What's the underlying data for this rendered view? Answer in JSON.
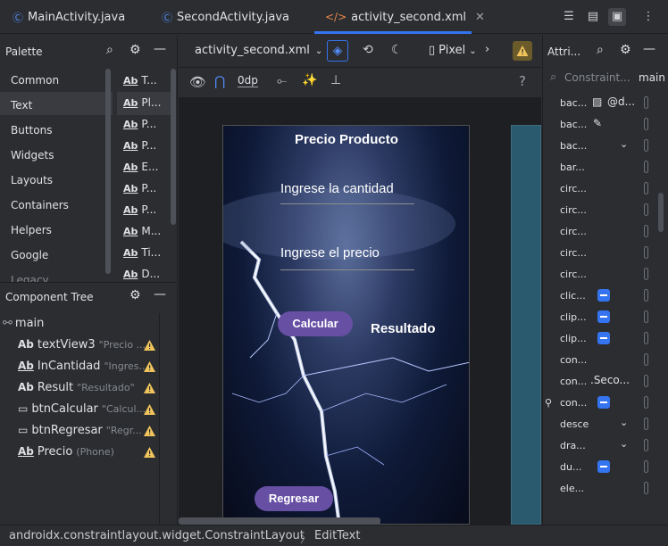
{
  "tabs": [
    {
      "label": "MainActivity.java",
      "icon": "c-class-icon"
    },
    {
      "label": "SecondActivity.java",
      "icon": "c-class-icon"
    },
    {
      "label": "activity_second.xml",
      "icon": "xml-icon"
    }
  ],
  "palette": {
    "title": "Palette",
    "categories": [
      "Common",
      "Text",
      "Buttons",
      "Widgets",
      "Layouts",
      "Containers",
      "Helpers",
      "Google",
      "Legacy"
    ],
    "selected_category": "Text",
    "items": [
      "T...",
      "Pl...",
      "P...",
      "P...",
      "E...",
      "P...",
      "P...",
      "M...",
      "Ti...",
      "D..."
    ]
  },
  "component_tree": {
    "title": "Component Tree",
    "root": "main",
    "items": [
      {
        "lead": "Ab",
        "name": "textView3",
        "hint": "\"Precio ..."
      },
      {
        "lead": "Ab",
        "name": "InCantidad",
        "hint": "\"Ingres..."
      },
      {
        "lead": "Ab",
        "name": "Result",
        "hint": "\"Resultado\""
      },
      {
        "lead": "▭",
        "name": "btnCalcular",
        "hint": "\"Calcul..."
      },
      {
        "lead": "▭",
        "name": "btnRegresar",
        "hint": "\"Regr..."
      },
      {
        "lead": "Ab",
        "name": "Precio",
        "hint": "(Phone)"
      }
    ]
  },
  "editor": {
    "file": "activity_second.xml",
    "device": "Pixel",
    "margin": "0dp"
  },
  "phone": {
    "title": "Precio Producto",
    "qty_hint": "Ingrese la cantidad",
    "price_hint": "Ingrese el precio",
    "calc_button": "Calcular",
    "result": "Resultado",
    "back_button": "Regresar"
  },
  "attributes": {
    "title": "Attri...",
    "search_text": "Constraint...",
    "scope": "main",
    "rows": [
      {
        "name": "bac...",
        "value": "@d..."
      },
      {
        "name": "bac...",
        "value": ""
      },
      {
        "name": "bac...",
        "value": ""
      },
      {
        "name": "bar...",
        "value": ""
      },
      {
        "name": "circ...",
        "value": ""
      },
      {
        "name": "circ...",
        "value": ""
      },
      {
        "name": "circ...",
        "value": ""
      },
      {
        "name": "circ...",
        "value": ""
      },
      {
        "name": "circ...",
        "value": ""
      },
      {
        "name": "clic...",
        "value": ""
      },
      {
        "name": "clip...",
        "value": ""
      },
      {
        "name": "clip...",
        "value": ""
      },
      {
        "name": "con...",
        "value": ""
      },
      {
        "name": "con...",
        "value": ".Seco..."
      },
      {
        "name": "con...",
        "value": ""
      },
      {
        "name": "desce",
        "value": ""
      },
      {
        "name": "dra...",
        "value": ""
      },
      {
        "name": "du...",
        "value": ""
      },
      {
        "name": "ele...",
        "value": ""
      }
    ]
  },
  "status": {
    "path": "androidx.constraintlayout.widget.ConstraintLayout",
    "separator": "〉",
    "leaf": "EditText"
  },
  "colors": {
    "accent": "#3574f0",
    "warning": "#f2c55c",
    "button": "#6750a4"
  }
}
